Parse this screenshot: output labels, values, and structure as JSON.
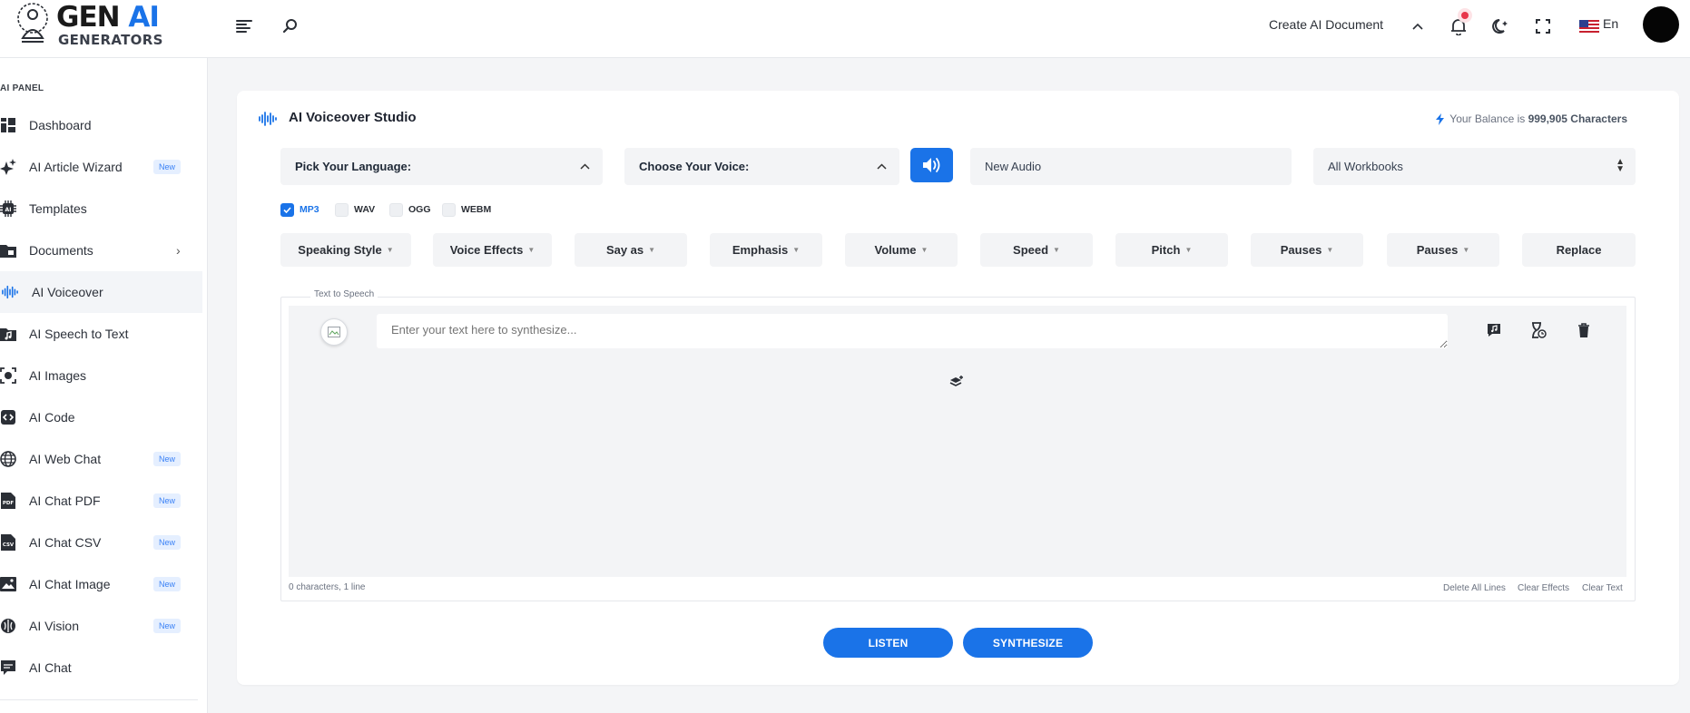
{
  "brand": {
    "title_main": "GEN ",
    "title_accent": "AI",
    "subtitle": "GENERATORS"
  },
  "header": {
    "create_doc": "Create AI Document",
    "language": "En"
  },
  "sidebar": {
    "panel_label": "AI PANEL",
    "new_badge": "New",
    "items": [
      {
        "label": "Dashboard"
      },
      {
        "label": "AI Article Wizard",
        "badge": "New"
      },
      {
        "label": "Templates"
      },
      {
        "label": "Documents"
      },
      {
        "label": "AI Voiceover"
      },
      {
        "label": "AI Speech to Text"
      },
      {
        "label": "AI Images"
      },
      {
        "label": "AI Code"
      },
      {
        "label": "AI Web Chat",
        "badge": "New"
      },
      {
        "label": "AI Chat PDF",
        "badge": "New"
      },
      {
        "label": "AI Chat CSV",
        "badge": "New"
      },
      {
        "label": "AI Chat Image",
        "badge": "New"
      },
      {
        "label": "AI Vision",
        "badge": "New"
      },
      {
        "label": "AI Chat"
      }
    ]
  },
  "studio": {
    "title": "AI Voiceover Studio",
    "balance_prefix": "Your Balance is ",
    "balance_value": "999,905 Characters",
    "language_select": "Pick Your Language:",
    "voice_select": "Choose Your Voice:",
    "audio_title_value": "New Audio",
    "workbooks": "All Workbooks",
    "formats": [
      "MP3",
      "WAV",
      "OGG",
      "WEBM"
    ],
    "effects": [
      "Speaking Style",
      "Voice Effects",
      "Say as",
      "Emphasis",
      "Volume",
      "Speed",
      "Pitch",
      "Pauses",
      "Pauses",
      "Replace"
    ],
    "tts_legend": "Text to Speech",
    "textarea_placeholder": "Enter your text here to synthesize...",
    "char_count": "0 characters, 1 line",
    "delete_all": "Delete All Lines",
    "clear_effects": "Clear Effects",
    "clear_text": "Clear Text",
    "listen": "LISTEN",
    "synthesize": "SYNTHESIZE"
  },
  "colors": {
    "accent": "#1a73e8",
    "notification": "#e8364a"
  }
}
